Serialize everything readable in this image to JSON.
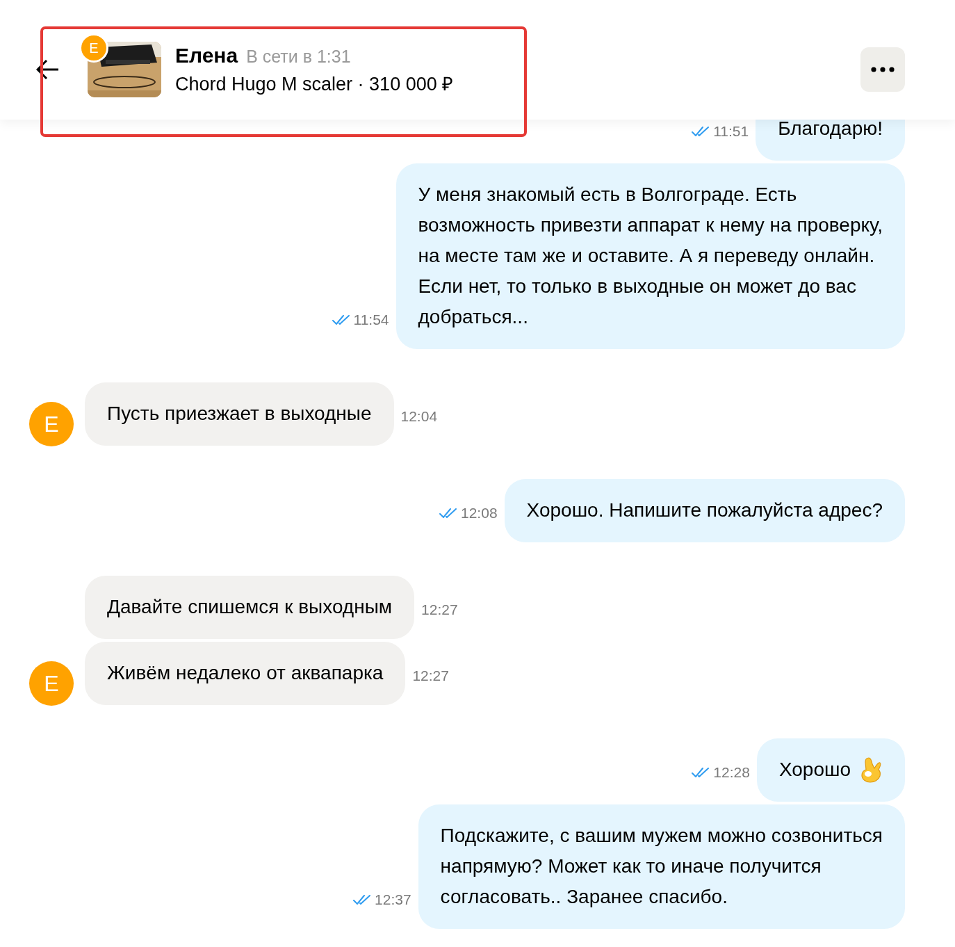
{
  "header": {
    "contact_initial": "Е",
    "name": "Елена",
    "status": "В сети в 1:31",
    "listing": "Chord Hugo M scaler · 310 000 ₽",
    "highlighted": true
  },
  "messages": [
    {
      "kind": "outgoing",
      "text": "Благодарю!",
      "time": "11:51",
      "read": true
    },
    {
      "kind": "outgoing",
      "text": "У меня знакомый есть в Волгограде. Есть\nвозможность привезти аппарат к нему на проверку,\nна месте там же и оставите. А я переведу онлайн.\nЕсли нет, то только в выходные он может до вас\nдобраться...",
      "time": "11:54",
      "read": true
    },
    {
      "kind": "incoming",
      "text": "Пусть приезжает в выходные",
      "time": "12:04",
      "avatar": "Е"
    },
    {
      "kind": "outgoing",
      "text": "Хорошо. Напишите пожалуйста адрес?",
      "time": "12:08",
      "read": true
    },
    {
      "kind": "incoming",
      "text": "Давайте спишемся к выходным",
      "time": "12:27"
    },
    {
      "kind": "incoming",
      "text": "Живём недалеко от аквапарка",
      "time": "12:27",
      "avatar": "Е"
    },
    {
      "kind": "outgoing",
      "text": "Хорошо",
      "time": "12:28",
      "read": true,
      "emoji": true
    },
    {
      "kind": "outgoing",
      "text": "Подскажите, с вашим мужем можно созвониться\nнапрямую? Может как то иначе получится\nсогласовать.. Заранее спасибо.",
      "time": "12:37",
      "read": true
    }
  ]
}
